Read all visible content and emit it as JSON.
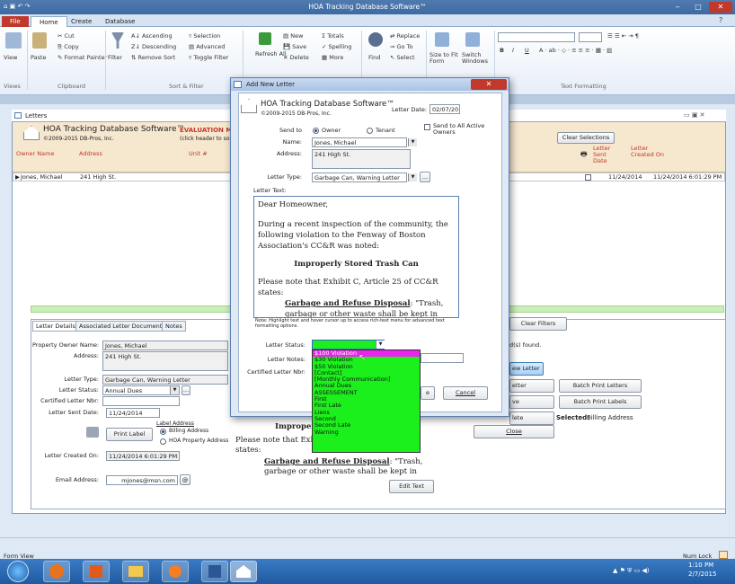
{
  "window": {
    "title": "HOA Tracking Database Software™",
    "min": "‒",
    "max": "□",
    "close": "✕"
  },
  "ribbon_tabs": [
    "File",
    "Home",
    "Create",
    "Database"
  ],
  "ribbon": {
    "views": {
      "view": "View",
      "group": "Views"
    },
    "clipboard": {
      "paste": "Paste",
      "cut": "Cut",
      "copy": "Copy",
      "format_painter": "Format Painter",
      "group": "Clipboard"
    },
    "sort": {
      "filter": "Filter",
      "ascending": "Ascending",
      "descending": "Descending",
      "remove_sort": "Remove Sort",
      "selection": "Selection",
      "advanced": "Advanced",
      "toggle_filter": "Toggle Filter",
      "group": "Sort & Filter"
    },
    "records": {
      "refresh": "Refresh All",
      "new": "New",
      "save": "Save",
      "delete": "Delete",
      "totals": "Totals",
      "spelling": "Spelling",
      "more": "More"
    },
    "find": {
      "find": "Find",
      "replace": "Replace",
      "goto": "Go To",
      "select": "Select"
    },
    "window": {
      "size": "Size to Fit Form",
      "switch": "Switch Windows"
    },
    "text": {
      "group": "Text Formatting",
      "bold": "B",
      "italic": "I",
      "underline": "U"
    }
  },
  "letters_tab": "Letters",
  "header": {
    "app": "HOA Tracking Database Software™",
    "copyright": "©2009-2015 DB-Pros, Inc.",
    "eval": "EVALUATION MO",
    "click_note": "(click header to sor",
    "clear_selections": "Clear Selections",
    "col_owner": "Owner Name",
    "col_address": "Address",
    "col_unit": "Unit #",
    "col_letter_sent": "Letter Sent Date",
    "col_letter_created": "Letter Created On"
  },
  "row": {
    "owner": "Jones, Michael",
    "address": "241 High St.",
    "sent": "11/24/2014",
    "created": "11/24/2014 6:01:29 PM"
  },
  "detail_tabs": [
    "Letter Details",
    "Associated Letter Documents",
    "Notes"
  ],
  "details": {
    "owner_label": "Property Owner Name:",
    "owner": "Jones, Michael",
    "address_label": "Address:",
    "address": "241 High St.",
    "type_label": "Letter Type:",
    "type": "Garbage Can, Warning Letter",
    "status_label": "Letter Status:",
    "status": "Annual Dues",
    "cert_label": "Certified Letter Nbr:",
    "sent_label": "Letter Sent Date:",
    "sent": "11/24/2014",
    "label_address": "Label Address",
    "print_label": "Print Label",
    "billing": "Billing Address",
    "hoa": "HOA Property Address",
    "created_label": "Letter Created On:",
    "created": "11/24/2014 6:01:29 PM",
    "email_label": "Email Address:",
    "email": "mjones@msn.com",
    "email_btn": "@"
  },
  "bg_letter": {
    "heading": "Improper",
    "para": "Please note that Exhi",
    "states": "states:",
    "rule_title": "Garbage and Refuse Disposal",
    "rule_text": ": \"Trash,",
    "rule_line2": "garbage or other waste shall be kept in"
  },
  "right_panel": {
    "clear_filters": "Clear Filters",
    "found": "d(s) found.",
    "new_letter": "ew Letter",
    "letter": "etter",
    "ve": "ve",
    "delete": "lete",
    "close": "Close",
    "batch_letters": "Batch Print Letters",
    "batch_labels": "Batch Print Labels",
    "selected": "Selected:",
    "selected_value": "Billing Address",
    "edit_text": "Edit Text"
  },
  "dialog": {
    "title": "Add New Letter",
    "close": "✕",
    "app": "HOA Tracking Database Software™",
    "copyright": "©2009-2015 DB-Pros, Inc.",
    "date_label": "Letter Date:",
    "date": "02/07/2015",
    "send_all": "Send to All Active Owners",
    "send_to": "Send to",
    "owner_opt": "Owner",
    "tenant_opt": "Tenant",
    "name_label": "Name:",
    "name": "Jones, Michael",
    "address_label": "Address:",
    "address": "241 High St.",
    "type_label": "Letter Type:",
    "type": "Garbage Can, Warning Letter",
    "type_btn": "...",
    "text_label": "Letter Text:",
    "letter": {
      "greeting": "Dear Homeowner,",
      "p1": "During a recent inspection of the community, the following violation to the Fenway of Boston Association's CC&R was noted:",
      "heading": "Improperly Stored Trash Can",
      "p2": "Please note that Exhibit C, Article 25 of CC&R states:",
      "rule_title": "Garbage and Refuse Disposal",
      "rule_text": ": \"Trash, garbage or other waste shall be kept in closed"
    },
    "hint": "Note: Highlight text and hover cursor up to access rich-text menu for advanced text formatting options.",
    "status_label": "Letter Status:",
    "notes_label": "Letter Notes:",
    "cert_label": "Certified Letter Nbr:",
    "save_fragment": "e",
    "cancel": "Cancel"
  },
  "status_options": [
    "$100 Violation",
    "$30 Violation",
    "$50 Violation",
    "[Contact]",
    "[Monthly Communication]",
    "Annual Dues",
    "ASSESSEMENT",
    "First",
    "First Late",
    "Liens",
    "Second",
    "Second Late",
    "Warning"
  ],
  "statusbar": {
    "left": "Form View",
    "right": "Num Lock"
  },
  "taskbar": {
    "time": "1:10 PM",
    "date": "2/7/2015"
  },
  "colors": {
    "accent": "#3e6aa3",
    "dropdown": "#1cf01c",
    "highlight": "#ee22ee"
  }
}
